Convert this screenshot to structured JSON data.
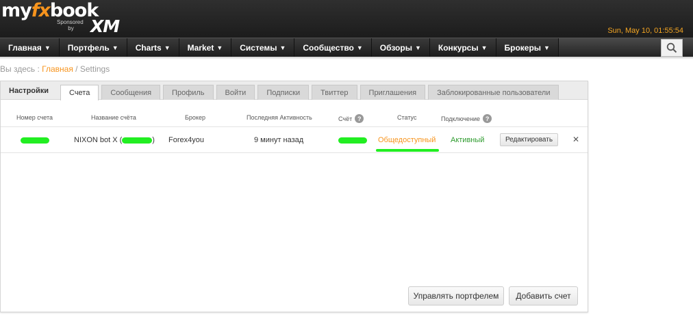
{
  "header": {
    "logo_my": "my",
    "logo_fx": "fx",
    "logo_book": "book",
    "sponsored": "Sponsored",
    "by": "by",
    "sponsor_logo": "XM",
    "datetime": "Sun, May 10, 01:55:54"
  },
  "nav": [
    {
      "label": "Главная",
      "caret": "▼"
    },
    {
      "label": "Портфель",
      "caret": "▼"
    },
    {
      "label": "Charts",
      "caret": "▼"
    },
    {
      "label": "Market",
      "caret": "▼"
    },
    {
      "label": "Системы",
      "caret": "▼"
    },
    {
      "label": "Сообщество",
      "caret": "▼"
    },
    {
      "label": "Обзоры",
      "caret": "▼"
    },
    {
      "label": "Конкурсы",
      "caret": "▼"
    },
    {
      "label": "Брокеры",
      "caret": "▼"
    }
  ],
  "search_icon": "search-icon",
  "breadcrumb": {
    "prefix": "Вы здесь :",
    "home": "Главная",
    "sep": "/",
    "current": "Settings"
  },
  "settings": {
    "title": "Настройки",
    "tabs": [
      "Счета",
      "Сообщения",
      "Профиль",
      "Войти",
      "Подписки",
      "Твиттер",
      "Приглашения",
      "Заблокированные пользователи"
    ],
    "active_tab": "Счета"
  },
  "table": {
    "headers": {
      "number": "Номер счета",
      "name": "Название счёта",
      "broker": "Брокер",
      "activity": "Последняя Активность",
      "account": "Счёт",
      "status": "Статус",
      "connection": "Подключение"
    },
    "help_glyph": "?",
    "row": {
      "name_prefix": "NIXON bot X (",
      "name_suffix": ")",
      "broker": "Forex4you",
      "activity": "9 минут назад",
      "status": "Общедоступный",
      "connection": "Активный",
      "edit": "Редактировать",
      "remove": "✕"
    }
  },
  "buttons": {
    "manage_portfolio": "Управлять портфелем",
    "add_account": "Добавить счет"
  },
  "colors": {
    "accent": "#f7941d",
    "active_green": "#2e9b2e",
    "redaction": "#22ee22"
  }
}
